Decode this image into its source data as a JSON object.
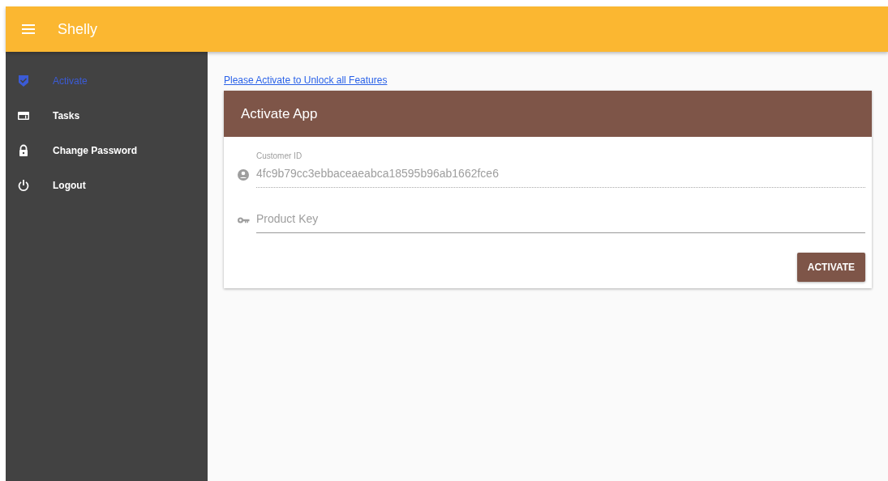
{
  "app_bar": {
    "title": "Shelly"
  },
  "sidebar": {
    "items": [
      {
        "label": "Activate",
        "selected": true
      },
      {
        "label": "Tasks",
        "selected": false
      },
      {
        "label": "Change Password",
        "selected": false
      },
      {
        "label": "Logout",
        "selected": false
      }
    ]
  },
  "notice_link": "Please Activate to Unlock all Features",
  "card": {
    "title": "Activate App",
    "fields": [
      {
        "label": "Customer ID",
        "value": "4fc9b79cc3ebbaceaeabca18595b96ab1662fce6",
        "disabled": true
      },
      {
        "placeholder": "Product Key",
        "disabled": false
      }
    ],
    "button": "ACTIVATE"
  }
}
